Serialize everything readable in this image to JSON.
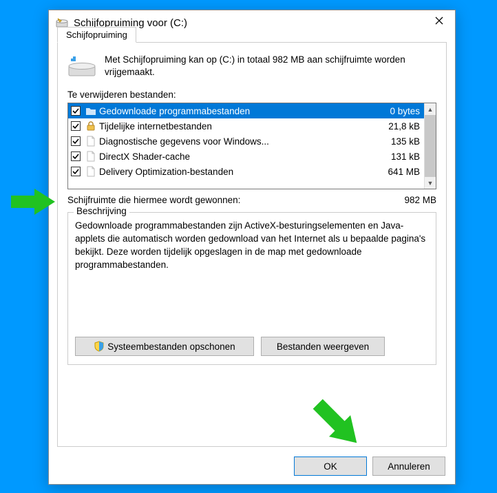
{
  "window": {
    "title": "Schijfopruiming voor  (C:)",
    "tab_label": "Schijfopruiming"
  },
  "intro": "Met Schijfopruiming kan op  (C:) in totaal 982 MB aan schijfruimte worden vrijgemaakt.",
  "files_label": "Te verwijderen bestanden:",
  "files": [
    {
      "name": "Gedownloade programmabestanden",
      "size": "0 bytes",
      "checked": true,
      "selected": true,
      "icon": "folder"
    },
    {
      "name": "Tijdelijke internetbestanden",
      "size": "21,8 kB",
      "checked": true,
      "selected": false,
      "icon": "lock"
    },
    {
      "name": "Diagnostische gegevens voor Windows...",
      "size": "135 kB",
      "checked": true,
      "selected": false,
      "icon": "file"
    },
    {
      "name": "DirectX Shader-cache",
      "size": "131 kB",
      "checked": true,
      "selected": false,
      "icon": "file"
    },
    {
      "name": "Delivery Optimization-bestanden",
      "size": "641 MB",
      "checked": true,
      "selected": false,
      "icon": "file"
    }
  ],
  "gain": {
    "label": "Schijfruimte die hiermee wordt gewonnen:",
    "value": "982 MB"
  },
  "description": {
    "legend": "Beschrijving",
    "text": "Gedownloade programmabestanden zijn ActiveX-besturingselementen en Java-applets die automatisch worden gedownload van het Internet als u bepaalde pagina's bekijkt. Deze worden tijdelijk opgeslagen in de map met gedownloade programmabestanden."
  },
  "buttons": {
    "cleanup_system": "Systeembestanden opschonen",
    "view_files": "Bestanden weergeven",
    "ok": "OK",
    "cancel": "Annuleren"
  }
}
